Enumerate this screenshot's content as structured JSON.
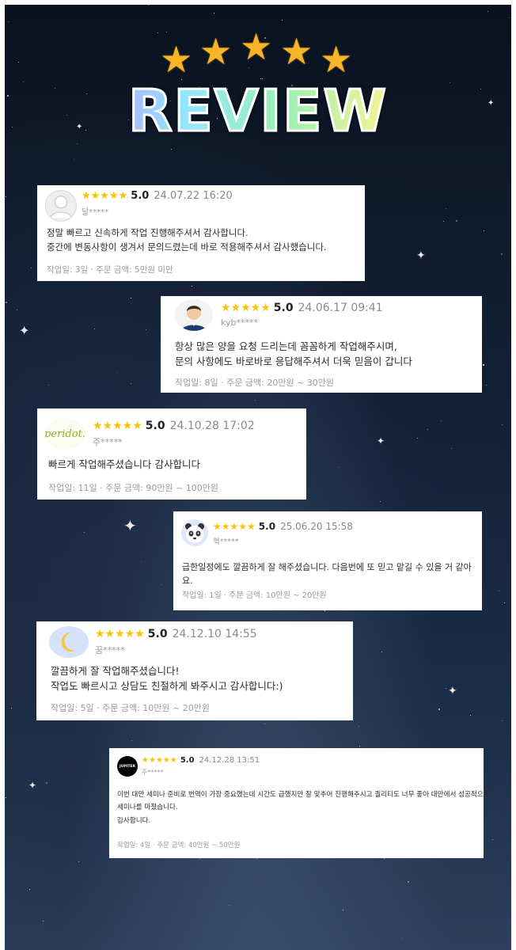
{
  "header": {
    "stars": [
      "★",
      "★",
      "★",
      "★",
      "★"
    ],
    "title": "REVIEW"
  },
  "colors": {
    "star_gold": "#f7b52a",
    "rating_star": "#f6c500",
    "card_bg": "#ffffff",
    "sky_top": "#0a121f",
    "sky_bottom": "#2c3f5c"
  },
  "reviews": [
    {
      "avatar": "default-profile-icon",
      "stars": "★★★★★",
      "score": "5.0",
      "date": "24.07.22 16:20",
      "user": "달*****",
      "lines": [
        "정말 빠르고 신속하게 작업 진행해주셔서 감사합니다.",
        "중간에 변동사항이 생겨서 문의드렸는데 바로 적용해주셔서 감사했습니다."
      ],
      "meta": "작업일: 3일 · 주문 금액: 5만원 미만"
    },
    {
      "avatar": "man-portrait-icon",
      "stars": "★★★★★",
      "score": "5.0",
      "date": "24.06.17 09:41",
      "user": "kyb*****",
      "lines": [
        "항상 많은 양을 요청 드리는데 꼼꼼하게 작업해주시며,",
        "문의 사항에도 바로바로 응답해주셔서 더욱 믿음이 갑니다"
      ],
      "meta": "작업일: 8일 · 주문 금액: 20만원 ~ 30만원"
    },
    {
      "avatar": "peridot-logo",
      "avatar_text": "peridot.",
      "stars": "★★★★★",
      "score": "5.0",
      "date": "24.10.28 17:02",
      "user": "주*****",
      "lines": [
        "빠르게 작업해주셨습니다 감사합니다"
      ],
      "meta": "작업일: 11일 · 주문 금액: 90만원 ~ 100만원"
    },
    {
      "avatar": "panda-icon",
      "stars": "★★★★★",
      "score": "5.0",
      "date": "25.06.20 15:58",
      "user": "혁*****",
      "lines": [
        "급한일정에도 깔끔하게 잘 해주셨습니다. 다음번에 또 믿고 맡길 수 있을 거 같아요."
      ],
      "meta": "작업일: 1일 · 주문 금액: 10만원 ~ 20만원"
    },
    {
      "avatar": "moon-icon",
      "stars": "★★★★★",
      "score": "5.0",
      "date": "24.12.10 14:55",
      "user": "꿈*****",
      "lines": [
        "깔끔하게 잘 작업해주셨습니다!",
        "작업도 빠르시고 상담도 친절하게 봐주시고 감사합니다:)"
      ],
      "meta": "작업일: 5일 · 주문 금액: 10만원 ~ 20만원"
    },
    {
      "avatar": "jupiter-logo",
      "avatar_text": "JUPITER",
      "stars": "★★★★★",
      "score": "5.0",
      "date": "24.12.28 13:51",
      "user": "주*****",
      "lines": [
        "이번 대만 세미나 준비로 번역이 가장 중요했는데 시간도 급했지만 잘 맞추어 진행해주시고 퀄리티도 너무 좋아 대만에서 성공적으로",
        "세미나를 마쳤습니다.",
        "감사합니다."
      ],
      "meta": "작업일: 4일 · 주문 금액: 40만원 ~ 50만원"
    }
  ]
}
